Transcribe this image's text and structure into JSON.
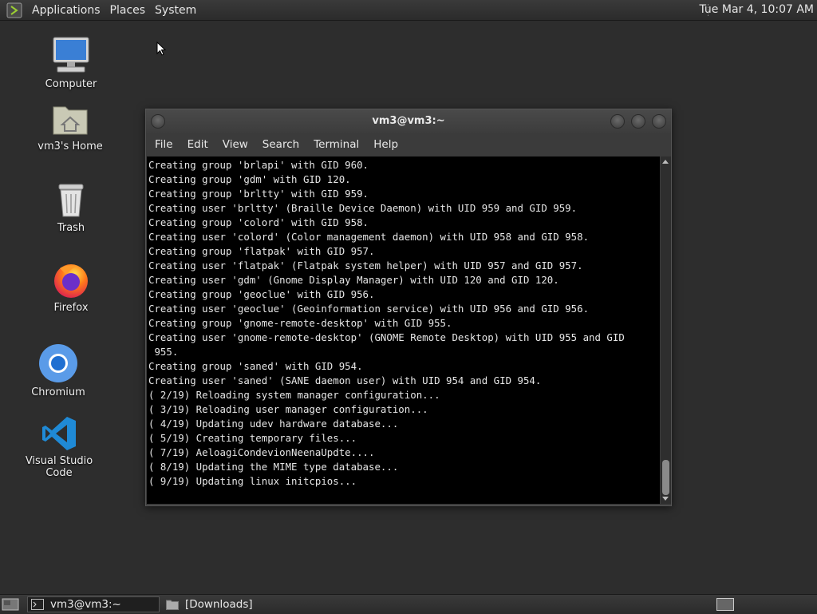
{
  "top_panel": {
    "menus": [
      "Applications",
      "Places",
      "System"
    ],
    "clock": "Tue Mar  4, 10:07 AM"
  },
  "desktop": {
    "icons": [
      {
        "label": "Computer",
        "icon": "computer-icon"
      },
      {
        "label": "vm3's Home",
        "icon": "home-folder-icon"
      },
      {
        "label": "Trash",
        "icon": "trash-icon"
      },
      {
        "label": "Firefox",
        "icon": "firefox-icon"
      },
      {
        "label": "Chromium",
        "icon": "chromium-icon"
      },
      {
        "label": "Visual Studio Code",
        "icon": "vscode-icon"
      }
    ]
  },
  "terminal": {
    "title": "vm3@vm3:~",
    "menu": [
      "File",
      "Edit",
      "View",
      "Search",
      "Terminal",
      "Help"
    ],
    "lines": [
      "Creating group 'brlapi' with GID 960.",
      "Creating group 'gdm' with GID 120.",
      "Creating group 'brltty' with GID 959.",
      "Creating user 'brltty' (Braille Device Daemon) with UID 959 and GID 959.",
      "Creating group 'colord' with GID 958.",
      "Creating user 'colord' (Color management daemon) with UID 958 and GID 958.",
      "Creating group 'flatpak' with GID 957.",
      "Creating user 'flatpak' (Flatpak system helper) with UID 957 and GID 957.",
      "Creating user 'gdm' (Gnome Display Manager) with UID 120 and GID 120.",
      "Creating group 'geoclue' with GID 956.",
      "Creating user 'geoclue' (Geoinformation service) with UID 956 and GID 956.",
      "Creating group 'gnome-remote-desktop' with GID 955.",
      "Creating user 'gnome-remote-desktop' (GNOME Remote Desktop) with UID 955 and GID",
      " 955.",
      "Creating group 'saned' with GID 954.",
      "Creating user 'saned' (SANE daemon user) with UID 954 and GID 954.",
      "( 2/19) Reloading system manager configuration...",
      "( 3/19) Reloading user manager configuration...",
      "( 4/19) Updating udev hardware database...",
      "( 5/19) Creating temporary files...",
      "( 7/19) AeloagiCondevionNeenaUpdte....",
      "( 8/19) Updating the MIME type database...",
      "( 9/19) Updating linux initcpios..."
    ]
  },
  "taskbar": {
    "tasks": [
      {
        "label": "vm3@vm3:~",
        "icon": "terminal-icon",
        "active": true
      },
      {
        "label": "[Downloads]",
        "icon": "folder-icon",
        "active": false
      }
    ]
  }
}
